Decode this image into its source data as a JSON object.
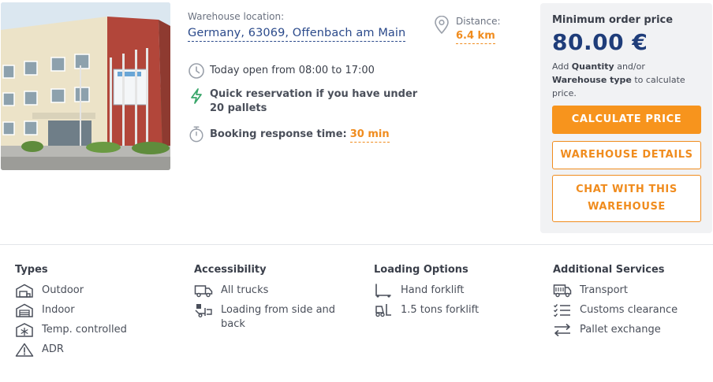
{
  "location": {
    "label": "Warehouse location:",
    "value": "Germany, 63069, Offenbach am Main"
  },
  "hours": "Today open from 08:00 to 17:00",
  "quick_reservation": "Quick reservation if you have under 20 pallets",
  "booking": {
    "label": "Booking response time:",
    "value": "30 min"
  },
  "distance": {
    "label": "Distance:",
    "value": "6.4 km"
  },
  "pricing": {
    "label": "Minimum order price",
    "price": "80.00 €",
    "hint_pre": "Add ",
    "hint_quantity": "Quantity",
    "hint_mid": " and/or ",
    "hint_type": "Warehouse type",
    "hint_post": " to calculate price."
  },
  "buttons": {
    "calculate": "CALCULATE PRICE",
    "details": "WAREHOUSE DETAILS",
    "chat": "CHAT WITH THIS WAREHOUSE"
  },
  "features": {
    "types": {
      "title": "Types",
      "items": [
        "Outdoor",
        "Indoor",
        "Temp. controlled",
        "ADR"
      ]
    },
    "accessibility": {
      "title": "Accessibility",
      "items": [
        "All trucks",
        "Loading from side and back"
      ]
    },
    "loading": {
      "title": "Loading Options",
      "items": [
        "Hand forklift",
        "1.5 tons forklift"
      ]
    },
    "services": {
      "title": "Additional Services",
      "items": [
        "Transport",
        "Customs clearance",
        "Pallet exchange"
      ]
    }
  },
  "colors": {
    "accent": "#f7941d",
    "link": "#2b4a8b",
    "price": "#1f3d7a",
    "green": "#3aa66a"
  },
  "icons": {
    "hours": "clock-icon",
    "quick": "lightning-icon",
    "booking": "stopwatch-icon",
    "distance": "location-pin-icon"
  }
}
